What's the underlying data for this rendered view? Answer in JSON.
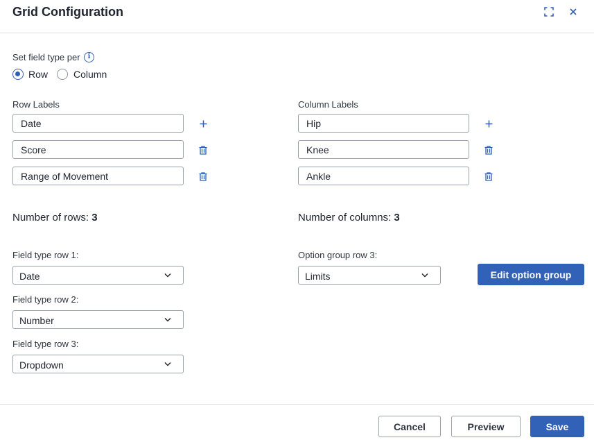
{
  "dialog": {
    "title": "Grid Configuration"
  },
  "field_type_per": {
    "label": "Set field type per",
    "options": [
      "Row",
      "Column"
    ],
    "selected": "Row"
  },
  "row_labels": {
    "heading": "Row Labels",
    "items": [
      "Date",
      "Score",
      "Range of Movement"
    ]
  },
  "column_labels": {
    "heading": "Column Labels",
    "items": [
      "Hip",
      "Knee",
      "Ankle"
    ]
  },
  "counts": {
    "rows_label": "Number of rows:",
    "rows_value": "3",
    "columns_label": "Number of columns:",
    "columns_value": "3"
  },
  "field_types": [
    {
      "label": "Field type row 1:",
      "value": "Date"
    },
    {
      "label": "Field type row 2:",
      "value": "Number"
    },
    {
      "label": "Field type row 3:",
      "value": "Dropdown"
    }
  ],
  "option_group": {
    "label": "Option group row 3:",
    "value": "Limits",
    "edit_button": "Edit option group"
  },
  "footer": {
    "cancel": "Cancel",
    "preview": "Preview",
    "save": "Save"
  },
  "icons": {
    "expand": "expand-icon",
    "close": "close-icon",
    "info": "info-icon",
    "add": "plus-icon",
    "delete": "trash-icon",
    "dropdown": "chevron-down-icon"
  },
  "colors": {
    "accent": "#3261b8",
    "border": "#9aa1ab",
    "divider": "#dde1e7"
  }
}
